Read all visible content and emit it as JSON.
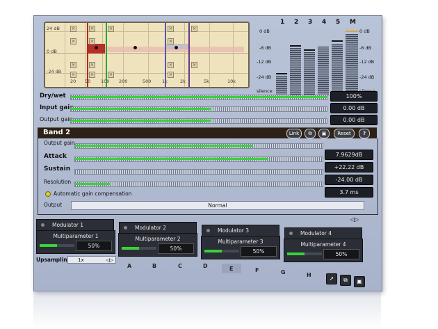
{
  "eq": {
    "db_labels": [
      "24 dB",
      "0 dB",
      "-24 dB"
    ],
    "freq_labels": [
      "20",
      "50",
      "100",
      "200",
      "500",
      "1k",
      "2k",
      "5k",
      "10k",
      "20k"
    ]
  },
  "meters": {
    "channels": [
      "1",
      "2",
      "3",
      "4",
      "5",
      "M"
    ],
    "left_scale": [
      "0 dB",
      "-6 dB",
      "-12 dB",
      "-24 dB",
      "silence"
    ],
    "right_scale": [
      "0 dB",
      "-6 dB",
      "-12 dB",
      "-24 dB",
      "silence"
    ]
  },
  "global": {
    "drywet_label": "Dry/wet",
    "drywet_value": "100%",
    "drywet_level": 1.0,
    "input_label": "Input gain",
    "input_value": "0.00 dB",
    "input_level": 0.55,
    "output_label": "Output gain",
    "output_value": "0.00 dB",
    "output_level": 0.55
  },
  "band": {
    "title": "Band 2",
    "link": "Link",
    "reset": "Reset",
    "help": "?",
    "output_label": "Output gain",
    "output_value": "7.9629dB",
    "output_level": 0.72,
    "attack_label": "Attack",
    "attack_value": "+22.22 dB",
    "attack_level": 0.78,
    "sustain_label": "Sustain",
    "sustain_value": "-24.00 dB",
    "sustain_level": 0.0,
    "resolution_label": "Resolution",
    "resolution_value": "3.7 ms",
    "resolution_level": 0.14,
    "agc_label": "Automatic gain compensation",
    "output_mode_label": "Output",
    "output_mode_value": "Normal"
  },
  "modulators": [
    {
      "label": "Modulator 1",
      "mp_label": "Multiparameter 1",
      "mp_value": "50%",
      "mp_level": 0.5
    },
    {
      "label": "Modulator 2",
      "mp_label": "Multiparameter 2",
      "mp_value": "50%",
      "mp_level": 0.5
    },
    {
      "label": "Modulator 3",
      "mp_label": "Multiparameter 3",
      "mp_value": "50%",
      "mp_level": 0.5
    },
    {
      "label": "Modulator 4",
      "mp_label": "Multiparameter 4",
      "mp_value": "50%",
      "mp_level": 0.5
    }
  ],
  "upsampling": {
    "label": "Upsampling",
    "value": "1x"
  },
  "presets": [
    "A",
    "B",
    "C",
    "D",
    "E",
    "F",
    "G",
    "H"
  ],
  "colors": {
    "accent": "#3bd13b",
    "panel": "#b1bcd2",
    "graph_bg": "#efe3bd",
    "band_bar": "#2d2117"
  }
}
